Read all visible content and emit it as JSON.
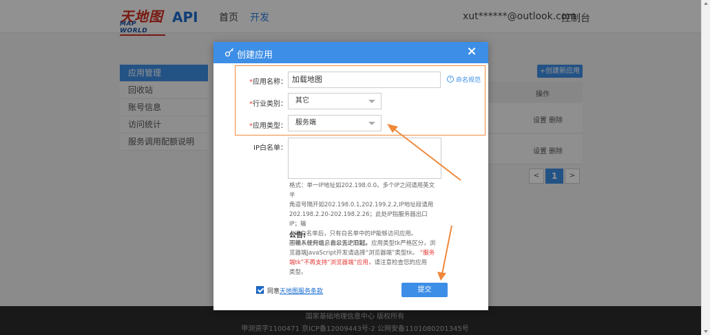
{
  "header": {
    "logo_cn": "天地图",
    "logo_en": "MAP WORLD",
    "api_label": "API",
    "nav": [
      "首页",
      "开发"
    ],
    "user_email": "xut******@outlook.com",
    "console": "控制台"
  },
  "sidebar": {
    "items": [
      "应用管理",
      "回收站",
      "账号信息",
      "访问统计",
      "服务调用配额说明"
    ]
  },
  "background": {
    "create_button": "+创建新应用",
    "ops_header": "操作",
    "row_ops": [
      "设置 删除",
      "设置 删除"
    ],
    "pager": {
      "prev": "<",
      "current": "1",
      "next": ">"
    }
  },
  "footer": {
    "line1": "国家基础地理信息中心 版权所有",
    "line2": "甲测资字1100471  京ICP备12009443号-2  公网安备11010802013​45号"
  },
  "modal": {
    "title": "创建应用",
    "close": "×",
    "fields": {
      "name_label": "应用名称：",
      "name_value": "加载地图",
      "name_help": "命名规范",
      "industry_label": "行业类别：",
      "industry_value": "其它",
      "type_label": "应用类型：",
      "type_value": "服务端",
      "ip_label": "IP白名单："
    },
    "required_mark": "*",
    "format_notes": [
      "格式：单一IP地址如202.198.0.0。多个IP之间请用英文半",
      "角逗号隔开如202.198.0.1,202.199.2.2,IP地址段请用",
      "202.198.2.20-202.198.2.26；此处IP指服务器出口IP；输",
      "入IP白名单后，只有白名单中的IP能够访问应用。",
      "不输入任何信息表示无IP限制。"
    ],
    "notice_title": "公告:",
    "notice_lines": [
      "因新系统升级，自公告之日起，应用类型tk严格区分，浏",
      "览器端JavaScript开发请选择“浏览器端”类型tk。",
      "端tk”不再支持“浏览器端”应用，",
      "类型。"
    ],
    "notice_red_1": "“服务",
    "notice_red_2": "端tk”不再支持“浏览器端”应用，",
    "notice_tail": "请注意检查您的应用",
    "agree_prefix": "同意",
    "agree_link": "天地图服务条款",
    "submit": "提交"
  },
  "colors": {
    "brand_blue": "#3d8ee6",
    "highlight_orange": "#f0883a",
    "required_red": "#e53935"
  }
}
